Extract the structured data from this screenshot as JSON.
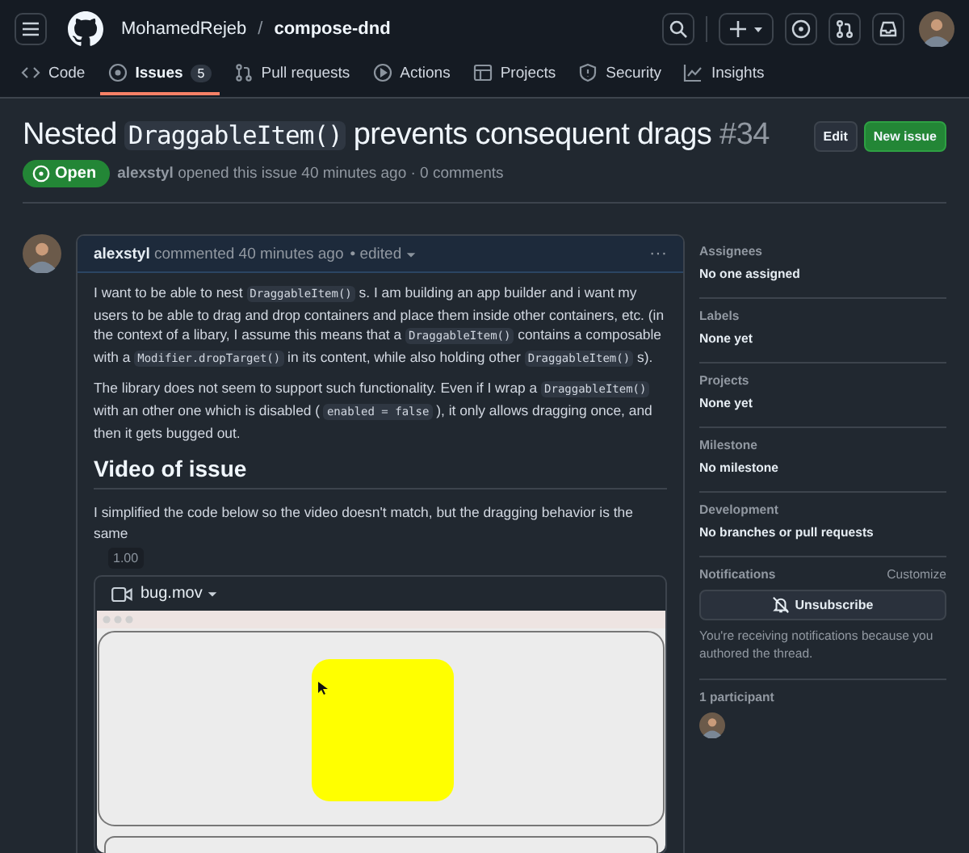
{
  "header": {
    "owner": "MohamedRejeb",
    "separator": "/",
    "repo": "compose-dnd"
  },
  "tabs": [
    {
      "label": "Code",
      "selected": false
    },
    {
      "label": "Issues",
      "count": "5",
      "selected": true
    },
    {
      "label": "Pull requests",
      "selected": false
    },
    {
      "label": "Actions",
      "selected": false
    },
    {
      "label": "Projects",
      "selected": false
    },
    {
      "label": "Security",
      "selected": false
    },
    {
      "label": "Insights",
      "selected": false
    }
  ],
  "issue": {
    "title": [
      {
        "kind": "text",
        "text": "Nested "
      },
      {
        "kind": "code",
        "text": "DraggableItem()"
      },
      {
        "kind": "text",
        "text": " prevents consequent drags"
      }
    ],
    "number": "#34",
    "edit_button": "Edit",
    "new_button": "New issue",
    "state": "Open",
    "meta": [
      {
        "kind": "bold",
        "text": "alexstyl"
      },
      {
        "kind": "text",
        "text": " opened this issue 40 minutes ago · 0 comments"
      }
    ]
  },
  "comment": {
    "author": "alexstyl",
    "meta": "commented 40 minutes ago",
    "edited": "• edited",
    "more": "···",
    "paragraphs": [
      [
        {
          "kind": "text",
          "text": "I want to be able to nest "
        },
        {
          "kind": "code",
          "text": "DraggableItem()"
        },
        {
          "kind": "text",
          "text": " s. I am building an app builder and i want my users to be able to drag and drop containers and place them inside other containers, etc. (in the context of a libary, I assume this means that a "
        },
        {
          "kind": "code",
          "text": "DraggableItem()"
        },
        {
          "kind": "text",
          "text": " contains a composable with a "
        },
        {
          "kind": "code",
          "text": "Modifier.dropTarget()"
        },
        {
          "kind": "text",
          "text": " in its content, while also holding other "
        },
        {
          "kind": "code",
          "text": "DraggableItem()"
        },
        {
          "kind": "text",
          "text": " s)."
        }
      ],
      [
        {
          "kind": "text",
          "text": "The library does not seem to support such functionality. Even if I wrap a "
        },
        {
          "kind": "code",
          "text": "DraggableItem()"
        },
        {
          "kind": "text",
          "text": " with an other one which is disabled ( "
        },
        {
          "kind": "code",
          "text": "enabled = false"
        },
        {
          "kind": "text",
          "text": " ), it only allows dragging once, and then it gets bugged out."
        }
      ]
    ],
    "heading": "Video of issue",
    "after": "I simplified the code below so the video doesn't match, but the dragging behavior is the same",
    "tooltip": "1.00",
    "video": {
      "file": "bug.mov",
      "kind": "picture"
    }
  },
  "sidebar": [
    {
      "label": "Assignees",
      "value": "No one assigned"
    },
    {
      "label": "Labels",
      "value": "None yet"
    },
    {
      "label": "Projects",
      "value": "None yet"
    },
    {
      "label": "Milestone",
      "value": "No milestone"
    },
    {
      "label": "Development",
      "value": "No branches or pull requests"
    }
  ],
  "notifications": {
    "label": "Notifications",
    "customize": "Customize",
    "button": "Unsubscribe",
    "note": "You're receiving notifications because you authored the thread."
  },
  "participants": {
    "label": "1 participant"
  }
}
